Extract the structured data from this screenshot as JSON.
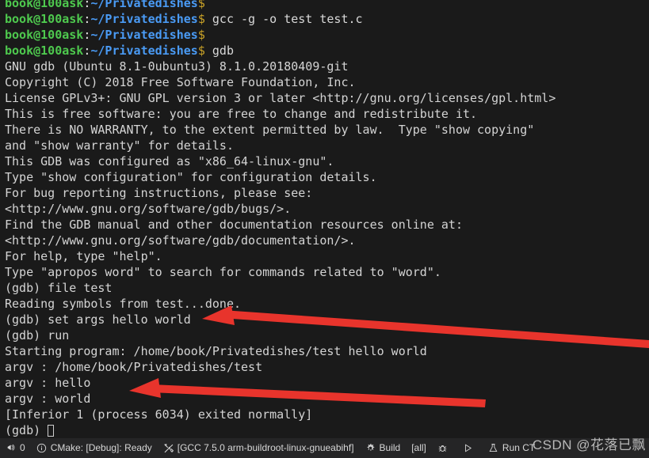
{
  "terminal": {
    "prompt": {
      "user": "book@100ask",
      "colon": ":",
      "path": "~/Privatedishes",
      "dollar": "$"
    },
    "commands": {
      "gcc": " gcc -g -o test test.c",
      "empty": "",
      "gdb": " gdb"
    },
    "gdb_banner": [
      "GNU gdb (Ubuntu 8.1-0ubuntu3) 8.1.0.20180409-git",
      "Copyright (C) 2018 Free Software Foundation, Inc.",
      "License GPLv3+: GNU GPL version 3 or later <http://gnu.org/licenses/gpl.html>",
      "This is free software: you are free to change and redistribute it.",
      "There is NO WARRANTY, to the extent permitted by law.  Type \"show copying\"",
      "and \"show warranty\" for details.",
      "This GDB was configured as \"x86_64-linux-gnu\".",
      "Type \"show configuration\" for configuration details.",
      "For bug reporting instructions, please see:",
      "<http://www.gnu.org/software/gdb/bugs/>.",
      "Find the GDB manual and other documentation resources online at:",
      "<http://www.gnu.org/software/gdb/documentation/>.",
      "For help, type \"help\".",
      "Type \"apropos word\" to search for commands related to \"word\"."
    ],
    "session": [
      "(gdb) file test",
      "Reading symbols from test...done.",
      "(gdb) set args hello world",
      "(gdb) run",
      "Starting program: /home/book/Privatedishes/test hello world",
      "argv : /home/book/Privatedishes/test",
      "argv : hello",
      "argv : world",
      "[Inferior 1 (process 6034) exited normally]"
    ],
    "final_prompt": "(gdb) ",
    "colors": {
      "background": "#1a1a1a",
      "user": "#4ec94e",
      "path": "#4a9bf5",
      "dollar": "#c9a227",
      "output": "#d4d4d4"
    }
  },
  "annotations": {
    "arrow_color": "#e8342c",
    "arrows": [
      {
        "name": "arrow-set-args",
        "label": ""
      },
      {
        "name": "arrow-argv-world",
        "label": ""
      }
    ]
  },
  "statusbar": {
    "background": "#252526",
    "items": [
      {
        "icon": "bell-icon",
        "label": "0"
      },
      {
        "icon": "info-circle-icon",
        "label": "CMake: [Debug]: Ready"
      },
      {
        "icon": "tools-icon",
        "label": "[GCC 7.5.0 arm-buildroot-linux-gnueabihf]"
      },
      {
        "icon": "gear-icon",
        "label": "Build"
      },
      {
        "icon": "none",
        "label": "[all]"
      },
      {
        "icon": "bug-icon",
        "label": ""
      },
      {
        "icon": "play-icon",
        "label": ""
      },
      {
        "icon": "beaker-icon",
        "label": "Run CT"
      }
    ]
  },
  "watermark": {
    "text": "CSDN @花落已飘"
  }
}
